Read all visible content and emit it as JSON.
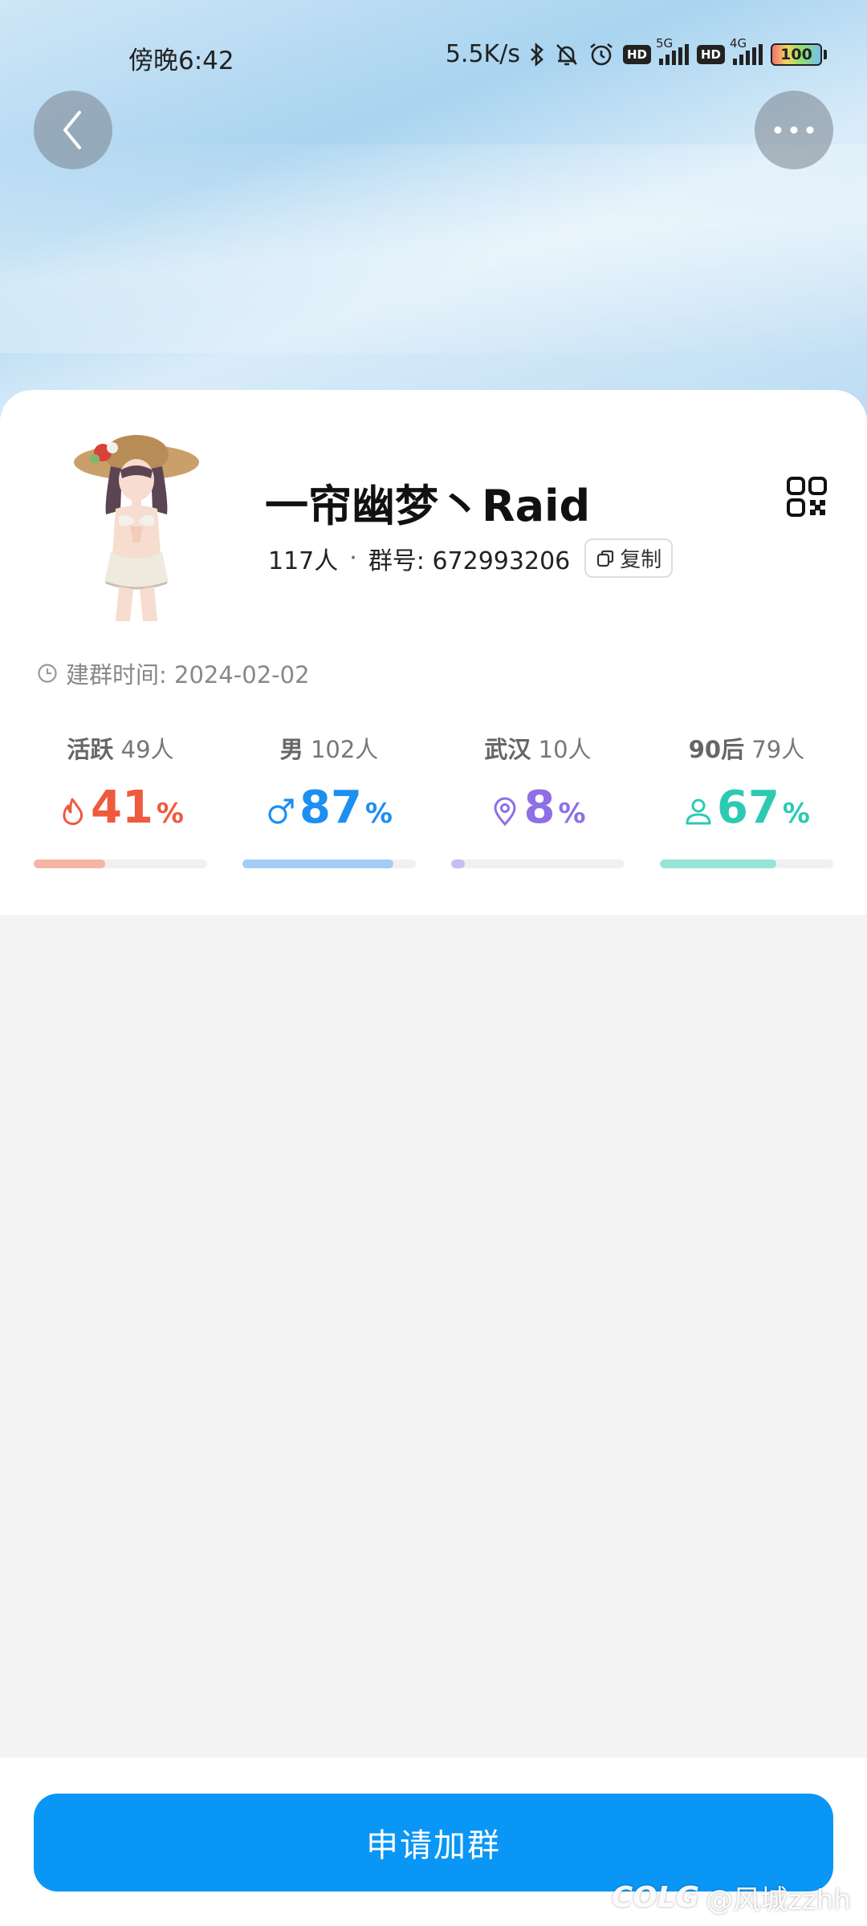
{
  "status_bar": {
    "time": "傍晚6:42",
    "speed": "5.5K/s",
    "hd1": "HD",
    "net1": "5G",
    "hd2": "HD",
    "net2": "4G",
    "battery": "100"
  },
  "header": {
    "back_icon": "chevron-left-icon",
    "more_icon": "more-horizontal-icon"
  },
  "group": {
    "name": "一帘幽梦丶Raid",
    "member_count": "117人",
    "separator": "·",
    "group_number_label": "群号: 672993206",
    "copy_label": "复制",
    "created_label": "建群时间: 2024-02-02"
  },
  "stats": [
    {
      "title": "活跃",
      "count": "49人",
      "value": "41",
      "unit": "%",
      "color": "#ef5a3f",
      "bar_color": "#f7b5a6",
      "fill": 0.41,
      "icon": "flame-icon"
    },
    {
      "title": "男",
      "count": "102人",
      "value": "87",
      "unit": "%",
      "color": "#1d8ff0",
      "bar_color": "#a3ccf7",
      "fill": 0.87,
      "icon": "male-icon"
    },
    {
      "title": "武汉",
      "count": "10人",
      "value": "8",
      "unit": "%",
      "color": "#8f6fe6",
      "bar_color": "#cbbcf3",
      "fill": 0.08,
      "icon": "location-pin-icon"
    },
    {
      "title": "90后",
      "count": "79人",
      "value": "67",
      "unit": "%",
      "color": "#2ccab3",
      "bar_color": "#96e5d8",
      "fill": 0.67,
      "icon": "person-icon"
    }
  ],
  "actions": {
    "join_label": "申请加群"
  },
  "watermark": {
    "logo": "COLG",
    "text": "@风城zzhh"
  }
}
